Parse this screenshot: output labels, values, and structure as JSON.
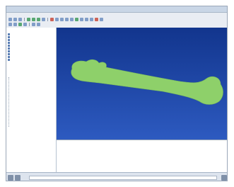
{
  "window": {
    "title": ""
  },
  "menubar": {
    "items": [
      "",
      "",
      "",
      "",
      "",
      "",
      "",
      "",
      "",
      ""
    ]
  },
  "model_tree": {
    "tab_label": "",
    "nodes": [
      "",
      "",
      "",
      "",
      "",
      "",
      "",
      "",
      "",
      ""
    ]
  },
  "viewport": {
    "background_top": "#12358d",
    "background_bottom": "#2d5ac0",
    "part_color": "#8ed06a",
    "part_name": "femur-bone-mesh"
  },
  "message_area": {
    "lines": [
      "",
      "",
      "",
      "",
      "",
      "",
      "",
      "",
      "",
      ""
    ]
  },
  "statusbar": {
    "prompt_label": "",
    "input_value": ""
  },
  "icons": [
    "file-icon",
    "save-icon",
    "print-icon",
    "zoom-icon",
    "rotate-icon",
    "pan-icon",
    "mesh-icon",
    "render-icon"
  ]
}
